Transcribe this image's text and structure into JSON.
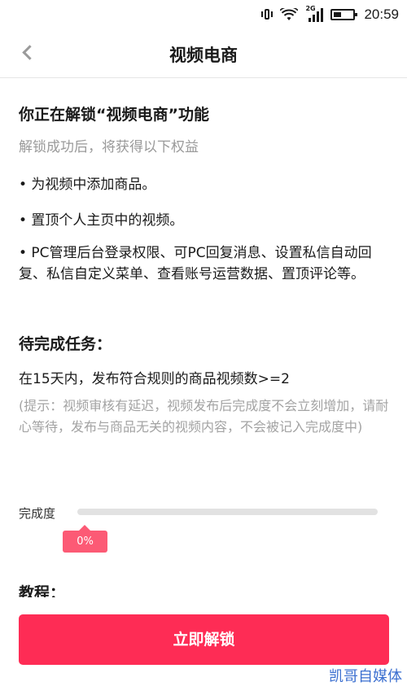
{
  "status_bar": {
    "network_tag": "2G",
    "time": "20:59"
  },
  "nav": {
    "title": "视频电商",
    "back_icon": "chevron-left-icon"
  },
  "content": {
    "headline": "你正在解锁“视频电商”功能",
    "subhead": "解锁成功后，将获得以下权益",
    "benefits": [
      "• 为视频中添加商品。",
      "• 置顶个人主页中的视频。",
      "• PC管理后台登录权限、可PC回复消息、设置私信自动回复、私信自定义菜单、查看账号运营数据、置顶评论等。"
    ],
    "task_title": "待完成任务：",
    "task_desc": "在15天内，发布符合规则的商品视频数>=2",
    "task_note": "(提示：视频审核有延迟，视频发布后完成度不会立刻增加，请耐心等待，发布与商品无关的视频内容，不会被记入完成度中)"
  },
  "progress": {
    "label": "完成度",
    "value_text": "0%",
    "fraction": 0.0
  },
  "tutorial_label": "教程：",
  "unlock_button": {
    "label": "立即解锁"
  },
  "watermark": "凯哥自媒体",
  "colors": {
    "accent": "#fe2c55",
    "badge": "#fc5a75",
    "muted_text": "#9a9a9a"
  }
}
